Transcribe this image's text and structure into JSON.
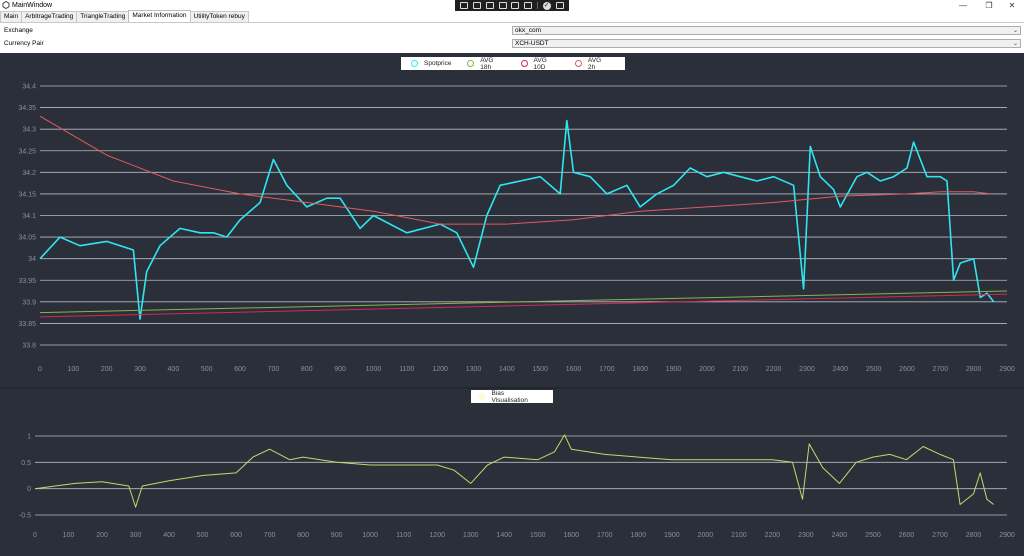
{
  "window": {
    "title": "MainWindow",
    "minimize": "—",
    "maximize": "❐",
    "close": "✕"
  },
  "tabs": [
    {
      "label": "Main"
    },
    {
      "label": "ArbitrageTrading"
    },
    {
      "label": "TriangleTrading"
    },
    {
      "label": "Market Information"
    },
    {
      "label": "UtilityToken rebuy"
    }
  ],
  "active_tab": "Market Information",
  "form": {
    "exchange_label": "Exchange",
    "exchange_value": "okx_com",
    "pair_label": "Currency Pair",
    "pair_value": "XCH-USDT"
  },
  "colors": {
    "chart_background": "#2b2f3a",
    "grid": "#cfd3da",
    "axis_text": "#8a8f99",
    "spot": "#2fe6f0",
    "avg18h": "#8bb34a",
    "avg10d": "#d02a5e",
    "avg2h": "#e05b5b",
    "bias": "#c9d66a"
  },
  "chart_data": [
    {
      "type": "line",
      "xlim": [
        0,
        2900
      ],
      "ylim": [
        33.8,
        34.4
      ],
      "yticks": [
        "34.4",
        "34.35",
        "34.3",
        "34.25",
        "34.2",
        "34.15",
        "34.1",
        "34.05",
        "34",
        "33.95",
        "33.9",
        "33.85",
        "33.8"
      ],
      "xticks": [
        "0",
        "100",
        "200",
        "300",
        "400",
        "500",
        "600",
        "700",
        "800",
        "900",
        "1000",
        "1100",
        "1200",
        "1300",
        "1400",
        "1500",
        "1600",
        "1700",
        "1800",
        "1900",
        "2000",
        "2100",
        "2200",
        "2300",
        "2400",
        "2500",
        "2600",
        "2700",
        "2800",
        "2900"
      ],
      "legend_position": "top-center",
      "grid": true,
      "series": [
        {
          "name": "Spotprice",
          "x": [
            0,
            60,
            120,
            200,
            280,
            300,
            320,
            360,
            420,
            480,
            520,
            560,
            600,
            660,
            700,
            740,
            800,
            860,
            900,
            960,
            1000,
            1100,
            1200,
            1250,
            1300,
            1340,
            1380,
            1440,
            1500,
            1560,
            1580,
            1600,
            1650,
            1700,
            1760,
            1800,
            1850,
            1900,
            1950,
            2000,
            2050,
            2100,
            2150,
            2200,
            2260,
            2290,
            2310,
            2340,
            2380,
            2400,
            2450,
            2480,
            2520,
            2560,
            2600,
            2620,
            2660,
            2700,
            2720,
            2740,
            2760,
            2800,
            2820,
            2840,
            2860
          ],
          "y": [
            34,
            34.05,
            34.03,
            34.04,
            34.02,
            33.86,
            33.97,
            34.03,
            34.07,
            34.06,
            34.06,
            34.05,
            34.09,
            34.13,
            34.23,
            34.17,
            34.12,
            34.14,
            34.14,
            34.07,
            34.1,
            34.06,
            34.08,
            34.06,
            33.98,
            34.1,
            34.17,
            34.18,
            34.19,
            34.15,
            34.32,
            34.2,
            34.19,
            34.15,
            34.17,
            34.12,
            34.15,
            34.17,
            34.21,
            34.19,
            34.2,
            34.19,
            34.18,
            34.19,
            34.17,
            33.93,
            34.26,
            34.19,
            34.16,
            34.12,
            34.19,
            34.2,
            34.18,
            34.19,
            34.21,
            34.27,
            34.19,
            34.19,
            34.18,
            33.95,
            33.99,
            34.0,
            33.91,
            33.92,
            33.9
          ]
        },
        {
          "name": "AVG 18h",
          "x": [
            0,
            2900
          ],
          "y": [
            33.875,
            33.925
          ]
        },
        {
          "name": "AVG 10D",
          "x": [
            0,
            2900
          ],
          "y": [
            33.865,
            33.918
          ]
        },
        {
          "name": "AVG 2h",
          "x": [
            0,
            200,
            400,
            600,
            800,
            1000,
            1200,
            1400,
            1600,
            1800,
            2000,
            2200,
            2400,
            2600,
            2700,
            2800,
            2850
          ],
          "y": [
            34.33,
            34.24,
            34.18,
            34.15,
            34.13,
            34.11,
            34.08,
            34.08,
            34.09,
            34.11,
            34.12,
            34.13,
            34.145,
            34.15,
            34.155,
            34.155,
            34.15
          ]
        }
      ]
    },
    {
      "type": "line",
      "xlim": [
        0,
        2900
      ],
      "ylim": [
        -0.5,
        1
      ],
      "yticks": [
        "1",
        "0.5",
        "0",
        "-0.5"
      ],
      "xticks": [
        "0",
        "100",
        "200",
        "300",
        "400",
        "500",
        "600",
        "700",
        "800",
        "900",
        "1000",
        "1100",
        "1200",
        "1300",
        "1400",
        "1500",
        "1600",
        "1700",
        "1800",
        "1900",
        "2000",
        "2100",
        "2200",
        "2300",
        "2400",
        "2500",
        "2600",
        "2700",
        "2800",
        "2900"
      ],
      "legend_position": "top-center",
      "grid": true,
      "series": [
        {
          "name": "Bias Visualisation",
          "x": [
            0,
            60,
            120,
            200,
            280,
            300,
            320,
            400,
            500,
            600,
            650,
            700,
            760,
            800,
            900,
            1000,
            1100,
            1200,
            1250,
            1300,
            1350,
            1400,
            1500,
            1550,
            1580,
            1600,
            1700,
            1800,
            1900,
            2000,
            2100,
            2200,
            2260,
            2290,
            2310,
            2350,
            2400,
            2450,
            2500,
            2550,
            2600,
            2650,
            2700,
            2740,
            2760,
            2800,
            2820,
            2840,
            2860
          ],
          "y": [
            0,
            0.05,
            0.1,
            0.13,
            0.05,
            -0.35,
            0.05,
            0.15,
            0.25,
            0.3,
            0.6,
            0.75,
            0.55,
            0.6,
            0.5,
            0.45,
            0.45,
            0.45,
            0.35,
            0.1,
            0.45,
            0.6,
            0.55,
            0.7,
            1.02,
            0.75,
            0.65,
            0.6,
            0.55,
            0.55,
            0.55,
            0.55,
            0.5,
            -0.2,
            0.85,
            0.4,
            0.1,
            0.5,
            0.6,
            0.65,
            0.55,
            0.8,
            0.65,
            0.55,
            -0.3,
            -0.1,
            0.3,
            -0.2,
            -0.3
          ]
        }
      ]
    }
  ]
}
